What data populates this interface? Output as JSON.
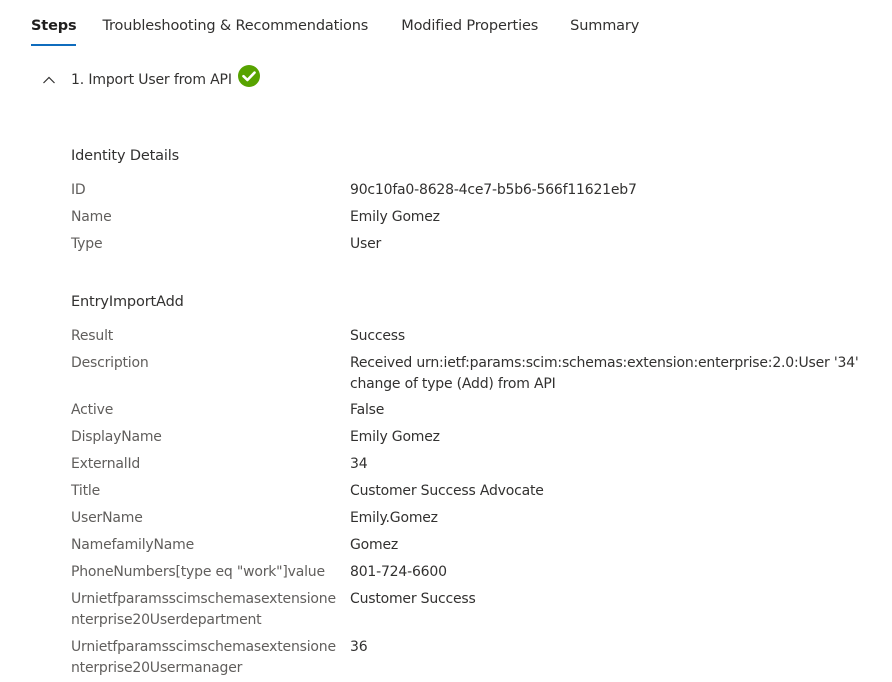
{
  "tabs": [
    {
      "label": "Steps",
      "active": true
    },
    {
      "label": "Troubleshooting & Recommendations",
      "active": false
    },
    {
      "label": "Modified Properties",
      "active": false
    },
    {
      "label": "Summary",
      "active": false
    }
  ],
  "step": {
    "title": "1. Import User from API",
    "status_icon": "success-check-icon",
    "status_color": "#57a300",
    "expanded": true,
    "toggle_icon": "chevron-up-icon"
  },
  "identity_details": {
    "title": "Identity Details",
    "rows": [
      {
        "label": "ID",
        "value": "90c10fa0-8628-4ce7-b5b6-566f11621eb7"
      },
      {
        "label": "Name",
        "value": "Emily Gomez"
      },
      {
        "label": "Type",
        "value": "User"
      }
    ]
  },
  "entry_import_add": {
    "title": "EntryImportAdd",
    "rows": [
      {
        "label": "Result",
        "value": "Success"
      },
      {
        "label": "Description",
        "value": "Received urn:ietf:params:scim:schemas:extension:enterprise:2.0:User '34' change of type (Add) from API"
      },
      {
        "label": "Active",
        "value": "False"
      },
      {
        "label": "DisplayName",
        "value": "Emily Gomez"
      },
      {
        "label": "ExternalId",
        "value": "34"
      },
      {
        "label": "Title",
        "value": "Customer Success Advocate"
      },
      {
        "label": "UserName",
        "value": "Emily.Gomez"
      },
      {
        "label": "NamefamilyName",
        "value": "Gomez"
      },
      {
        "label": "PhoneNumbers[type eq \"work\"]value",
        "value": "801-724-6600"
      },
      {
        "label": "Urnietfparamsscimschemasextensionenterprise20Userdepartment",
        "value": "Customer Success"
      },
      {
        "label": "Urnietfparamsscimschemasextensionenterprise20Usermanager",
        "value": "36"
      }
    ]
  },
  "colors": {
    "accent": "#0f6cbd",
    "success": "#57a300",
    "label_text": "#605e5c",
    "value_text": "#323130"
  }
}
